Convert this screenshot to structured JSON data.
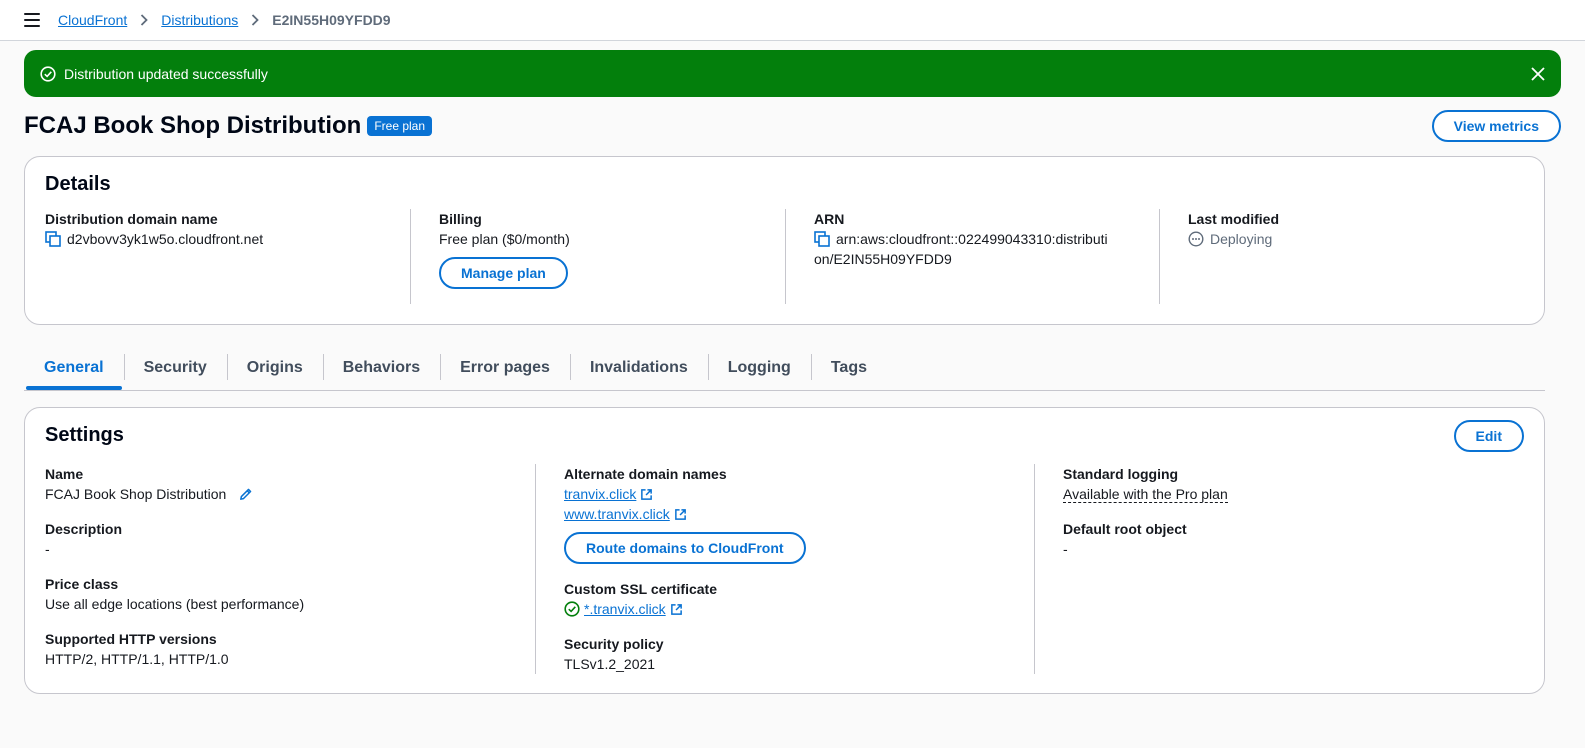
{
  "breadcrumb": {
    "items": [
      "CloudFront",
      "Distributions"
    ],
    "current": "E2IN55H09YFDD9"
  },
  "flash": {
    "message": "Distribution updated successfully"
  },
  "header": {
    "title": "FCAJ Book Shop Distribution",
    "badge": "Free plan",
    "view_metrics_label": "View metrics"
  },
  "details": {
    "heading": "Details",
    "domain_label": "Distribution domain name",
    "domain_value": "d2vbovv3yk1w5o.cloudfront.net",
    "billing_label": "Billing",
    "billing_value": "Free plan ($0/month)",
    "manage_plan_label": "Manage plan",
    "arn_label": "ARN",
    "arn_line1": "arn:aws:cloudfront::022499043310:distributi",
    "arn_line2": "on/E2IN55H09YFDD9",
    "last_modified_label": "Last modified",
    "last_modified_value": "Deploying"
  },
  "tabs": [
    "General",
    "Security",
    "Origins",
    "Behaviors",
    "Error pages",
    "Invalidations",
    "Logging",
    "Tags"
  ],
  "settings": {
    "heading": "Settings",
    "edit_label": "Edit",
    "name_label": "Name",
    "name_value": "FCAJ Book Shop Distribution",
    "description_label": "Description",
    "description_value": "-",
    "price_class_label": "Price class",
    "price_class_value": "Use all edge locations (best performance)",
    "http_versions_label": "Supported HTTP versions",
    "http_versions_value": "HTTP/2, HTTP/1.1, HTTP/1.0",
    "alt_domains_label": "Alternate domain names",
    "alt_domains": [
      "tranvix.click",
      "www.tranvix.click"
    ],
    "route_domains_label": "Route domains to CloudFront",
    "ssl_label": "Custom SSL certificate",
    "ssl_value": "*.tranvix.click",
    "security_policy_label": "Security policy",
    "security_policy_value": "TLSv1.2_2021",
    "standard_logging_label": "Standard logging",
    "standard_logging_value": "Available with the Pro plan",
    "default_root_label": "Default root object",
    "default_root_value": "-"
  },
  "colors": {
    "accent": "#0972d3",
    "success": "#037f0c",
    "text": "#16191f",
    "muted": "#5f6b7a"
  },
  "icons": [
    "menu-icon",
    "chevron-right-icon",
    "success-check-icon",
    "close-icon",
    "copy-icon",
    "pending-icon",
    "pencil-icon",
    "external-link-icon"
  ]
}
